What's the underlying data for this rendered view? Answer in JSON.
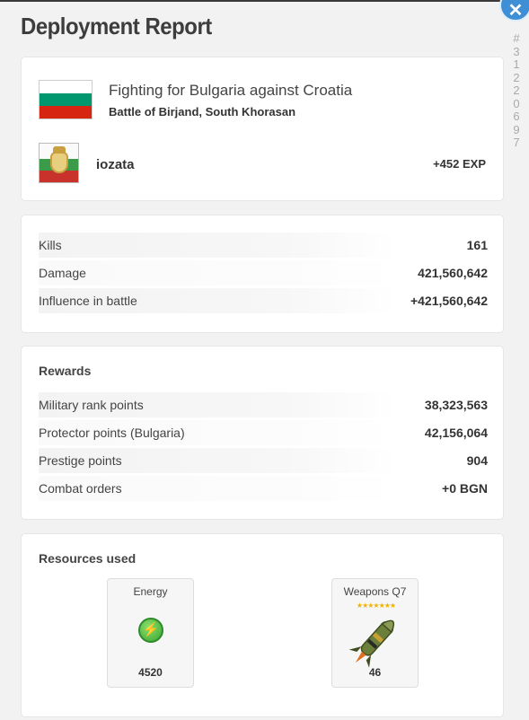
{
  "header": {
    "title": "Deployment Report",
    "close_glyph": "✕"
  },
  "side_id": [
    "#",
    "3",
    "1",
    "2",
    "2",
    "0",
    "6",
    "9",
    "7"
  ],
  "battle": {
    "title": "Fighting for Bulgaria against Croatia",
    "subtitle": "Battle of Birjand, South Khorasan",
    "flag_icon": "bulgaria-flag",
    "flag_colors": [
      "#ffffff",
      "#00966e",
      "#d62612"
    ],
    "username": "iozata",
    "exp": "+452 EXP"
  },
  "stats": [
    {
      "label": "Kills",
      "value": "161"
    },
    {
      "label": "Damage",
      "value": "421,560,642"
    },
    {
      "label": "Influence in battle",
      "value": "+421,560,642"
    }
  ],
  "rewards": {
    "title": "Rewards",
    "items": [
      {
        "label": "Military rank points",
        "value": "38,323,563"
      },
      {
        "label": "Protector points (Bulgaria)",
        "value": "42,156,064"
      },
      {
        "label": "Prestige points",
        "value": "904"
      },
      {
        "label": "Combat orders",
        "value": "+0 BGN"
      }
    ]
  },
  "resources": {
    "title": "Resources used",
    "items": [
      {
        "name": "Energy",
        "value": "4520",
        "icon": "energy-icon"
      },
      {
        "name": "Weapons Q7",
        "value": "46",
        "icon": "missile-icon",
        "stars": "★★★★★★★"
      }
    ]
  },
  "colors": {
    "accent": "#3e8fd6",
    "energy": "#3aa534",
    "stars": "#f0b400"
  }
}
